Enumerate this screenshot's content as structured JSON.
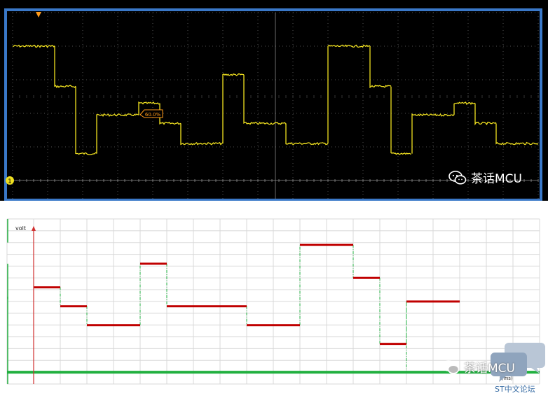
{
  "top_panel": {
    "trigger_label": "1",
    "cursor_readout": "60.0%",
    "watermark": "茶话MCU",
    "colors": {
      "background": "#000000",
      "frame": "#3a78c8",
      "trace": "#f0e020",
      "grid": "#6a6a6a"
    }
  },
  "chart_data": [
    {
      "type": "line",
      "subtype": "oscilloscope-step-waveform",
      "grid": true,
      "steps": [
        {
          "t_start": 0,
          "t_end": 1.2,
          "level": 8
        },
        {
          "t_start": 1.2,
          "t_end": 1.8,
          "level": 5.6
        },
        {
          "t_start": 1.8,
          "t_end": 2.4,
          "level": 1.6
        },
        {
          "t_start": 2.4,
          "t_end": 3.6,
          "level": 3.9
        },
        {
          "t_start": 3.6,
          "t_end": 4.2,
          "level": 4.6
        },
        {
          "t_start": 4.2,
          "t_end": 4.8,
          "level": 3.4
        },
        {
          "t_start": 4.8,
          "t_end": 6.0,
          "level": 2.2
        },
        {
          "t_start": 6.0,
          "t_end": 6.6,
          "level": 6.3
        },
        {
          "t_start": 6.6,
          "t_end": 7.8,
          "level": 3.4
        },
        {
          "t_start": 7.8,
          "t_end": 9.0,
          "level": 2.2
        },
        {
          "t_start": 9.0,
          "t_end": 10.2,
          "level": 8
        },
        {
          "t_start": 10.2,
          "t_end": 10.8,
          "level": 5.6
        },
        {
          "t_start": 10.8,
          "t_end": 11.4,
          "level": 1.6
        },
        {
          "t_start": 11.4,
          "t_end": 12.6,
          "level": 3.9
        },
        {
          "t_start": 12.6,
          "t_end": 13.2,
          "level": 4.6
        },
        {
          "t_start": 13.2,
          "t_end": 13.8,
          "level": 3.4
        },
        {
          "t_start": 13.8,
          "t_end": 14.4,
          "level": 2.2
        },
        {
          "t_start": 14.4,
          "t_end": 15.0,
          "level": 2.2
        }
      ],
      "xlim": [
        0,
        15
      ],
      "ylim": [
        0,
        10
      ]
    },
    {
      "type": "line",
      "subtype": "step-diagram",
      "ylabel": "volt",
      "xlabel": "t(ms)",
      "grid": true,
      "xlim": [
        -1,
        19
      ],
      "ylim": [
        -0.5,
        6.5
      ],
      "steps": [
        {
          "t_start": 0,
          "t_end": 1,
          "level": 3.6
        },
        {
          "t_start": 1,
          "t_end": 2,
          "level": 2.8
        },
        {
          "t_start": 2,
          "t_end": 4,
          "level": 2.0
        },
        {
          "t_start": 4,
          "t_end": 5,
          "level": 4.6
        },
        {
          "t_start": 5,
          "t_end": 8,
          "level": 2.8
        },
        {
          "t_start": 8,
          "t_end": 10,
          "level": 2.0
        },
        {
          "t_start": 10,
          "t_end": 12,
          "level": 5.4
        },
        {
          "t_start": 12,
          "t_end": 13,
          "level": 4.0
        },
        {
          "t_start": 13,
          "t_end": 14,
          "level": 1.2
        },
        {
          "t_start": 14,
          "t_end": 16,
          "level": 3.0
        }
      ],
      "baseline": 0,
      "colors": {
        "steps": "#c00000",
        "baseline": "#22b040",
        "axis": "#d03030",
        "grid": "#d8d8d8"
      }
    }
  ],
  "bottom_panel": {
    "watermark": "茶话MCU",
    "forum_label": "ST中文论坛"
  }
}
